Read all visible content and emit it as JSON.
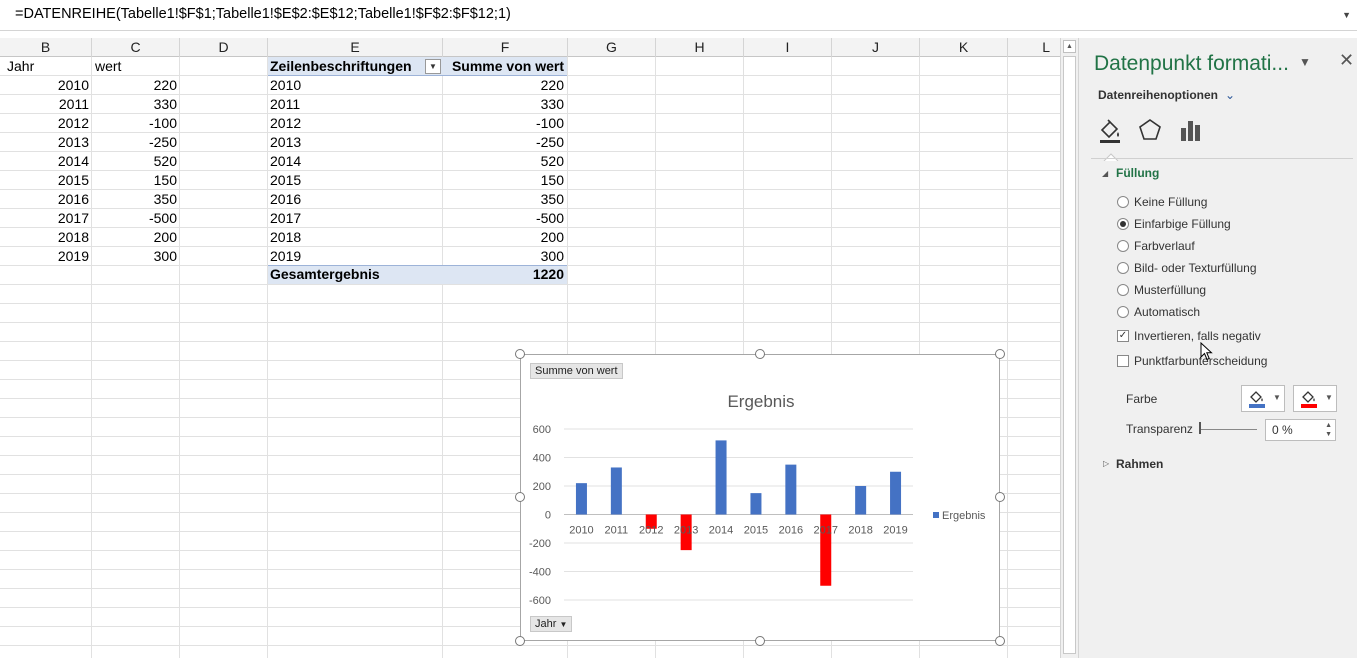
{
  "formula": "=DATENREIHE(Tabelle1!$F$1;Tabelle1!$E$2:$E$12;Tabelle1!$F$2:$F$12;1)",
  "columns": [
    "B",
    "C",
    "D",
    "E",
    "F",
    "G",
    "H",
    "I",
    "J",
    "K",
    "L"
  ],
  "sheet": {
    "headers": {
      "jahr": "Jahr",
      "wert": "wert"
    },
    "years": [
      "2010",
      "2011",
      "2012",
      "2013",
      "2014",
      "2015",
      "2016",
      "2017",
      "2018",
      "2019"
    ],
    "values": [
      "220",
      "330",
      "-100",
      "-250",
      "520",
      "150",
      "350",
      "-500",
      "200",
      "300"
    ]
  },
  "pivot": {
    "row_label_header": "Zeilenbeschriftungen",
    "value_header": "Summe von wert",
    "years": [
      "2010",
      "2011",
      "2012",
      "2013",
      "2014",
      "2015",
      "2016",
      "2017",
      "2018",
      "2019"
    ],
    "values": [
      "220",
      "330",
      "-100",
      "-250",
      "520",
      "150",
      "350",
      "-500",
      "200",
      "300"
    ],
    "total_label": "Gesamtergebnis",
    "total_value": "1220"
  },
  "chart_data": {
    "type": "bar",
    "title": "Ergebnis",
    "categories": [
      "2010",
      "2011",
      "2012",
      "2013",
      "2014",
      "2015",
      "2016",
      "2017",
      "2018",
      "2019"
    ],
    "series": [
      {
        "name": "Ergebnis",
        "values": [
          220,
          330,
          -100,
          -250,
          520,
          150,
          350,
          -500,
          200,
          300
        ]
      }
    ],
    "ylim": [
      -600,
      600
    ],
    "yticks": [
      "600",
      "400",
      "200",
      "0",
      "-200",
      "-400",
      "-600"
    ],
    "grid": true,
    "legend": "right",
    "positive_color": "#4472c4",
    "negative_color": "#ff0000",
    "field_buttons": {
      "value": "Summe  von wert",
      "axis": "Jahr"
    }
  },
  "pane": {
    "title": "Datenpunkt formati...",
    "subtitle": "Datenreihenoptionen",
    "tabs": [
      "fill-line-icon",
      "effects-pentagon-icon",
      "series-options-bar-icon"
    ],
    "fill_section": "Füllung",
    "options": [
      "Keine Füllung",
      "Einfarbige Füllung",
      "Farbverlauf",
      "Bild- oder Texturfüllung",
      "Musterfüllung",
      "Automatisch"
    ],
    "selected_option": 1,
    "invert_label": "Invertieren, falls negativ",
    "invert_checked": true,
    "vary_label": "Punktfarbunterscheidung",
    "vary_checked": false,
    "color_label": "Farbe",
    "color_positive": "#4472c4",
    "color_negative": "#ff0000",
    "transparency_label": "Transparenz",
    "transparency_value": "0 %",
    "border_section": "Rahmen"
  }
}
